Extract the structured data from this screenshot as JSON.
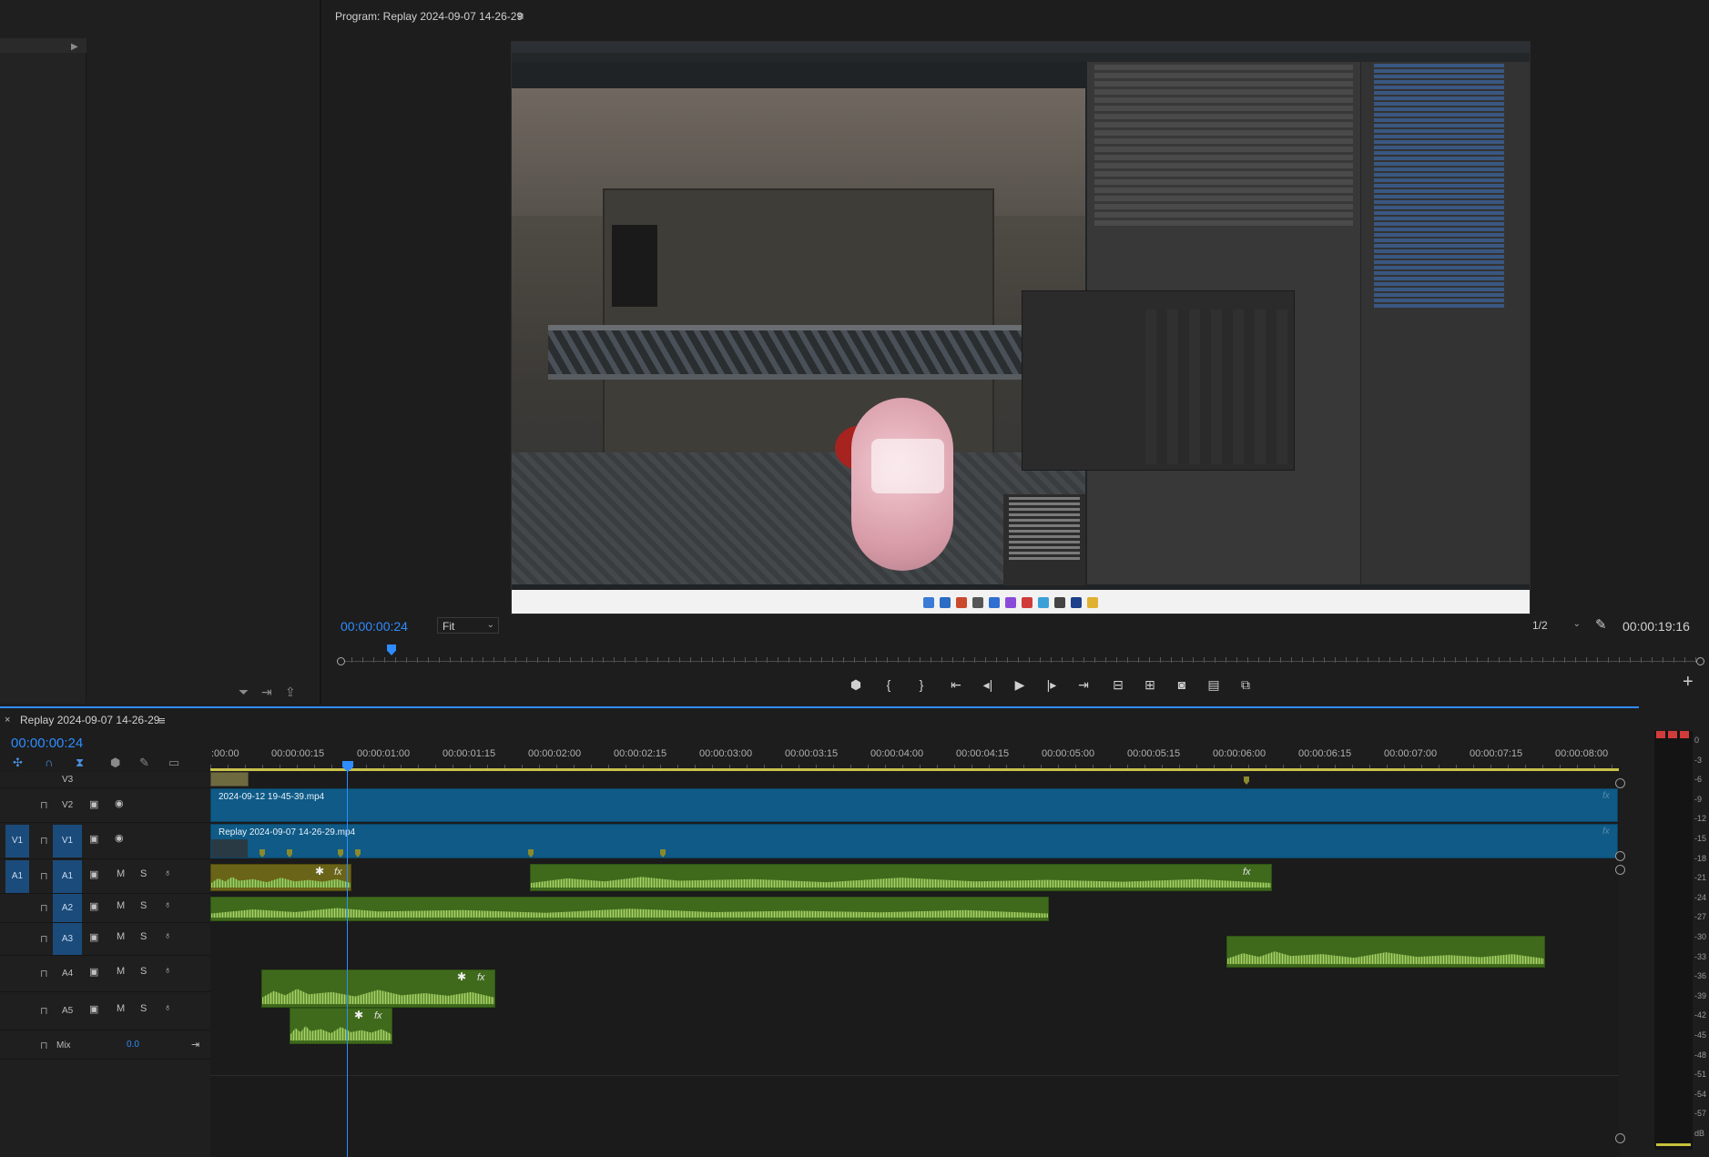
{
  "program_monitor": {
    "title": "Program: Replay 2024-09-07 14-26-29",
    "timecode": "00:00:00:24",
    "fit": "Fit",
    "resolution": "1/2",
    "duration": "00:00:19:16"
  },
  "timeline": {
    "title": "Replay 2024-09-07 14-26-29",
    "timecode": "00:00:00:24",
    "ruler_labels": [
      ":00:00",
      "00:00:00:15",
      "00:00:01:00",
      "00:00:01:15",
      "00:00:02:00",
      "00:00:02:15",
      "00:00:03:00",
      "00:00:03:15",
      "00:00:04:00",
      "00:00:04:15",
      "00:00:05:00",
      "00:00:05:15",
      "00:00:06:00",
      "00:00:06:15",
      "00:00:07:00",
      "00:00:07:15",
      "00:00:08:00"
    ],
    "tracks": {
      "v3": "V3",
      "v2": "V2",
      "v1": "V1",
      "v1_src": "V1",
      "a1": "A1",
      "a1_src": "A1",
      "a2": "A2",
      "a3": "A3",
      "a4": "A4",
      "a5": "A5",
      "mix": "Mix",
      "mix_value": "0.0"
    },
    "mute": "M",
    "solo": "S",
    "clips": {
      "v2_name": "2024-09-12 19-45-39.mp4",
      "v1_name": "Replay 2024-09-07 14-26-29.mp4"
    }
  },
  "meter": {
    "labels": [
      "0",
      "-3",
      "-6",
      "-9",
      "-12",
      "-15",
      "-18",
      "-21",
      "-24",
      "-27",
      "-30",
      "-33",
      "-36",
      "-39",
      "-42",
      "-45",
      "-48",
      "-51",
      "-54",
      "-57",
      "dB"
    ]
  },
  "icons": {
    "menu": "≡",
    "fx": "fx",
    "star": "✱",
    "lock": "🔒",
    "eye": "◉",
    "mic": "🎙",
    "film": "▣",
    "wrench": "🔧",
    "plus": "+"
  }
}
